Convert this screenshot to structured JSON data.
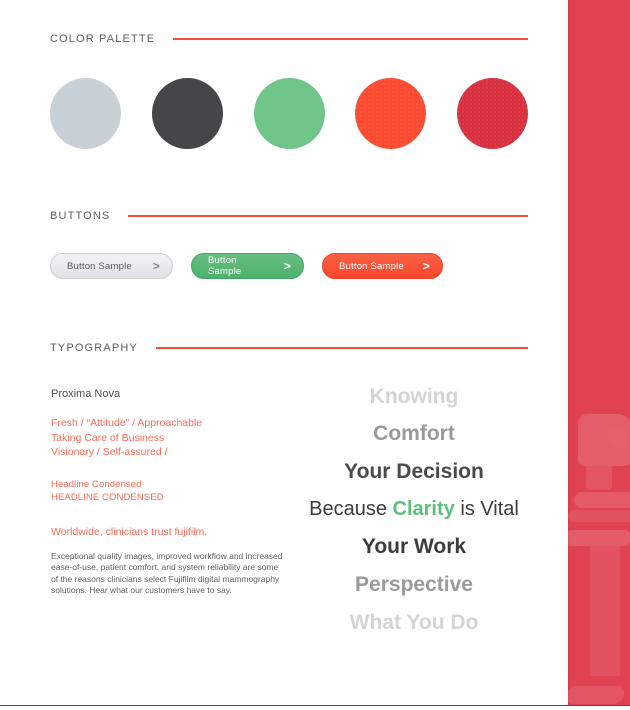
{
  "sections": {
    "palette": {
      "label": "COLOR PALETTE"
    },
    "buttons": {
      "label": "BUTTONS"
    },
    "typography": {
      "label": "TYPOGRAPHY"
    }
  },
  "rule_color": "#f2503c",
  "palette": {
    "swatches": [
      {
        "name": "light-gray-blue",
        "hex": "#c9d1d8",
        "textured": false
      },
      {
        "name": "charcoal",
        "hex": "#454647",
        "textured": false
      },
      {
        "name": "green",
        "hex": "#70c68a",
        "textured": false
      },
      {
        "name": "orange-red",
        "hex": "#fc4b31",
        "textured": true
      },
      {
        "name": "crimson",
        "hex": "#d8303f",
        "textured": true
      }
    ]
  },
  "buttons": [
    {
      "style": "gray",
      "label": "Button Sample",
      "chevron": ">"
    },
    {
      "style": "green",
      "label": "Button Sample",
      "chevron": ">"
    },
    {
      "style": "red",
      "label": "Button Sample",
      "chevron": ">"
    }
  ],
  "typography": {
    "font_name": "Proxima Nova",
    "tags": [
      "Fresh / “Attitude” / Approachable",
      "Taking Care of Business",
      "Visionary / Self-assured /"
    ],
    "condensed": [
      "Headline Condensed",
      "HEADLINE CONDENSED"
    ],
    "lead": "Worldwide, clinicians trust fujifilm.",
    "body": "Exceptional quality images, improved workflow and increased ease-of-use, patient comfort, and system reliability are some of the reasons clinicians select Fujifilm digital mammography solutions. Hear what our customers have to say.",
    "specimens": [
      {
        "text": "Knowing",
        "tone": "lightest"
      },
      {
        "text": "Comfort",
        "tone": "light"
      },
      {
        "text": "Your Decision",
        "tone": "dark"
      },
      {
        "text_before": "Because ",
        "highlight": "Clarity",
        "text_after": " is Vital",
        "tone": "dark"
      },
      {
        "text": "Your Work",
        "tone": "dark"
      },
      {
        "text": "Perspective",
        "tone": "light"
      },
      {
        "text": "What You Do",
        "tone": "lightest"
      }
    ],
    "highlight_color": "#5cbf7b"
  },
  "side_panel": {
    "color": "#e04252"
  }
}
